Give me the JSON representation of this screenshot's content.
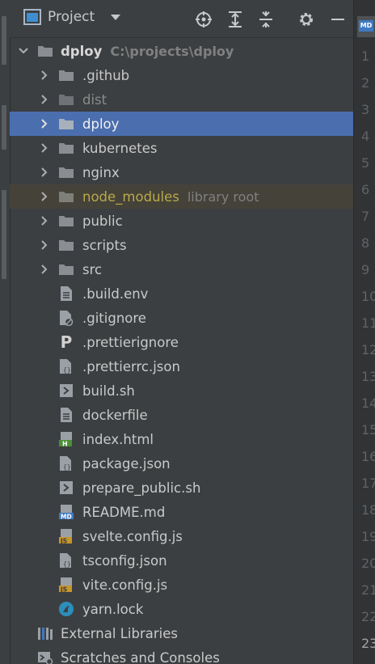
{
  "header": {
    "title": "Project"
  },
  "root": {
    "name": "dploy",
    "path": "C:\\projects\\dploy"
  },
  "folders": [
    {
      "name": ".github"
    },
    {
      "name": "dist"
    },
    {
      "name": "dploy"
    },
    {
      "name": "kubernetes"
    },
    {
      "name": "nginx"
    },
    {
      "name": "node_modules",
      "hint": "library root"
    },
    {
      "name": "public"
    },
    {
      "name": "scripts"
    },
    {
      "name": "src"
    }
  ],
  "files": [
    {
      "name": ".build.env"
    },
    {
      "name": ".gitignore"
    },
    {
      "name": ".prettierignore",
      "badge": "P"
    },
    {
      "name": ".prettierrc.json"
    },
    {
      "name": "build.sh"
    },
    {
      "name": "dockerfile"
    },
    {
      "name": "index.html",
      "badge": "H"
    },
    {
      "name": "package.json"
    },
    {
      "name": "prepare_public.sh"
    },
    {
      "name": "README.md",
      "badge": "MD"
    },
    {
      "name": "svelte.config.js",
      "badge": "JS"
    },
    {
      "name": "tsconfig.json"
    },
    {
      "name": "vite.config.js",
      "badge": "JS"
    },
    {
      "name": "yarn.lock"
    }
  ],
  "external_libraries": "External Libraries",
  "scratches": "Scratches and Consoles",
  "gutter": {
    "tab_badge": "MD",
    "line_numbers": [
      "1",
      "2",
      "3",
      "4",
      "5",
      "6",
      "7",
      "8",
      "9",
      "10",
      "11",
      "12",
      "13",
      "14",
      "15",
      "16",
      "17",
      "18",
      "19",
      "20",
      "21",
      "22",
      "23"
    ]
  },
  "colors": {
    "background": "#3c3f41",
    "selection": "#4b6eaf",
    "library_root": "#45423a",
    "folder": "#8a8e92",
    "yellow_text": "#b9a94a"
  }
}
